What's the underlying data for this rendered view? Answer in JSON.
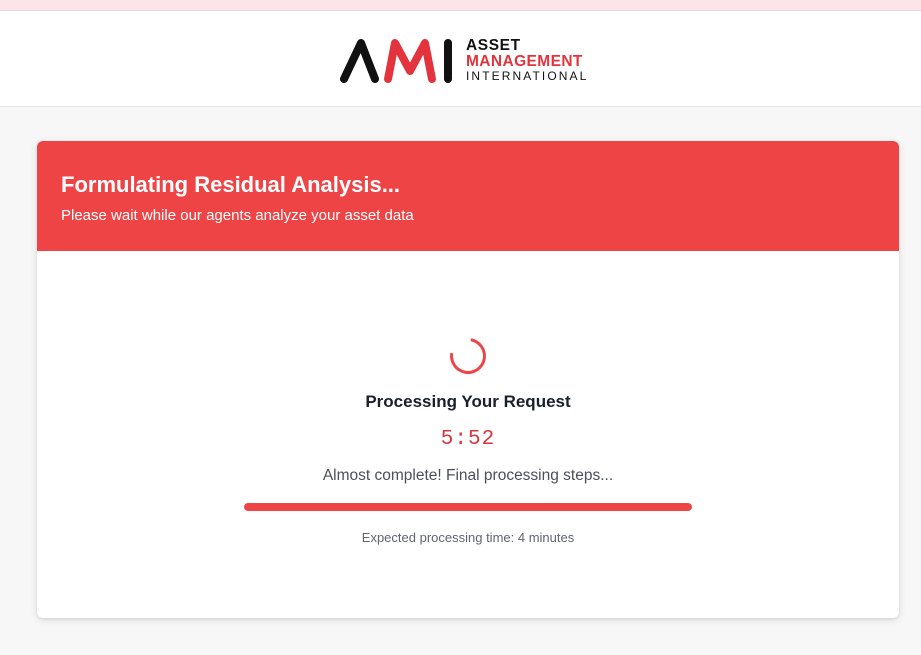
{
  "header": {
    "logo": {
      "mark_text": "AMI",
      "line1": "ASSET",
      "line2": "MANAGEMENT",
      "line3": "INTERNATIONAL"
    }
  },
  "card": {
    "title": "Formulating Residual Analysis...",
    "subtitle": "Please wait while our agents analyze your asset data",
    "spinner_icon": "loading-spinner",
    "processing_title": "Processing Your Request",
    "timer": "5:52",
    "status": "Almost complete! Final processing steps...",
    "progress_percent": 100,
    "expected_time": "Expected processing time: 4 minutes"
  },
  "colors": {
    "accent": "#ef4446",
    "timer": "#d8343b",
    "logo_red": "#e3343d",
    "top_strip": "#fde4e8"
  }
}
